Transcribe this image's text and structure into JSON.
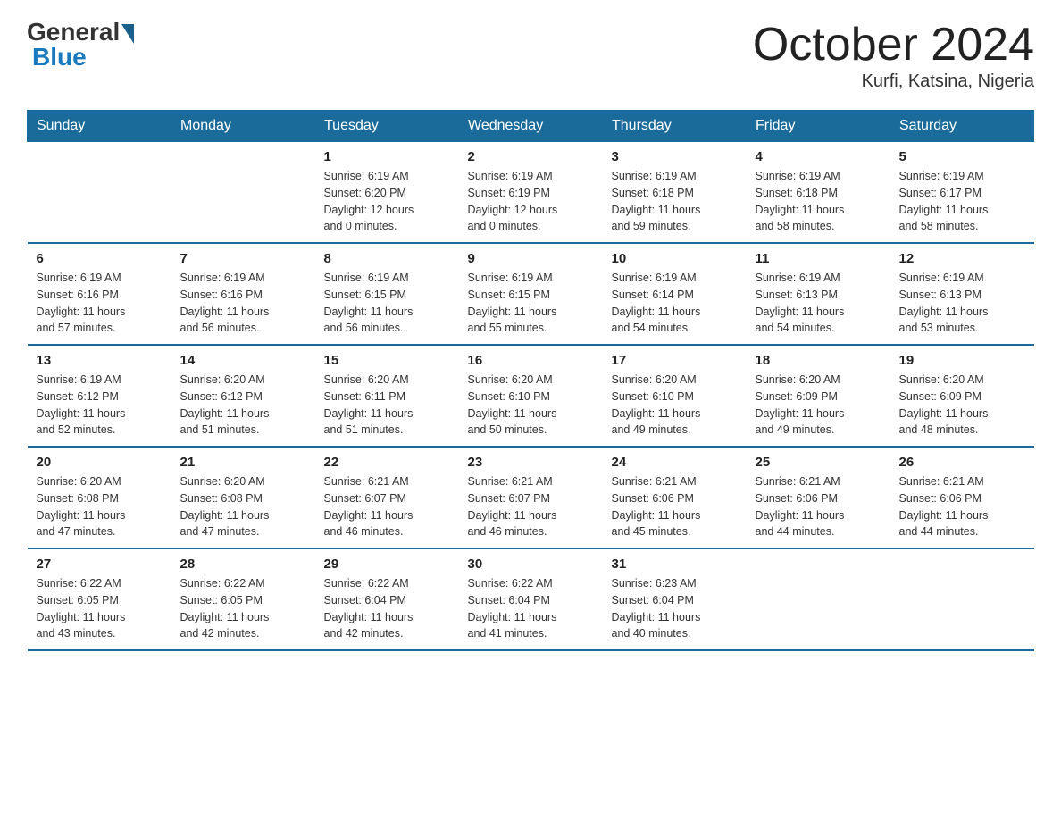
{
  "logo": {
    "general": "General",
    "blue": "Blue"
  },
  "title": "October 2024",
  "location": "Kurfi, Katsina, Nigeria",
  "days_header": [
    "Sunday",
    "Monday",
    "Tuesday",
    "Wednesday",
    "Thursday",
    "Friday",
    "Saturday"
  ],
  "weeks": [
    [
      {
        "day": "",
        "info": ""
      },
      {
        "day": "",
        "info": ""
      },
      {
        "day": "1",
        "info": "Sunrise: 6:19 AM\nSunset: 6:20 PM\nDaylight: 12 hours\nand 0 minutes."
      },
      {
        "day": "2",
        "info": "Sunrise: 6:19 AM\nSunset: 6:19 PM\nDaylight: 12 hours\nand 0 minutes."
      },
      {
        "day": "3",
        "info": "Sunrise: 6:19 AM\nSunset: 6:18 PM\nDaylight: 11 hours\nand 59 minutes."
      },
      {
        "day": "4",
        "info": "Sunrise: 6:19 AM\nSunset: 6:18 PM\nDaylight: 11 hours\nand 58 minutes."
      },
      {
        "day": "5",
        "info": "Sunrise: 6:19 AM\nSunset: 6:17 PM\nDaylight: 11 hours\nand 58 minutes."
      }
    ],
    [
      {
        "day": "6",
        "info": "Sunrise: 6:19 AM\nSunset: 6:16 PM\nDaylight: 11 hours\nand 57 minutes."
      },
      {
        "day": "7",
        "info": "Sunrise: 6:19 AM\nSunset: 6:16 PM\nDaylight: 11 hours\nand 56 minutes."
      },
      {
        "day": "8",
        "info": "Sunrise: 6:19 AM\nSunset: 6:15 PM\nDaylight: 11 hours\nand 56 minutes."
      },
      {
        "day": "9",
        "info": "Sunrise: 6:19 AM\nSunset: 6:15 PM\nDaylight: 11 hours\nand 55 minutes."
      },
      {
        "day": "10",
        "info": "Sunrise: 6:19 AM\nSunset: 6:14 PM\nDaylight: 11 hours\nand 54 minutes."
      },
      {
        "day": "11",
        "info": "Sunrise: 6:19 AM\nSunset: 6:13 PM\nDaylight: 11 hours\nand 54 minutes."
      },
      {
        "day": "12",
        "info": "Sunrise: 6:19 AM\nSunset: 6:13 PM\nDaylight: 11 hours\nand 53 minutes."
      }
    ],
    [
      {
        "day": "13",
        "info": "Sunrise: 6:19 AM\nSunset: 6:12 PM\nDaylight: 11 hours\nand 52 minutes."
      },
      {
        "day": "14",
        "info": "Sunrise: 6:20 AM\nSunset: 6:12 PM\nDaylight: 11 hours\nand 51 minutes."
      },
      {
        "day": "15",
        "info": "Sunrise: 6:20 AM\nSunset: 6:11 PM\nDaylight: 11 hours\nand 51 minutes."
      },
      {
        "day": "16",
        "info": "Sunrise: 6:20 AM\nSunset: 6:10 PM\nDaylight: 11 hours\nand 50 minutes."
      },
      {
        "day": "17",
        "info": "Sunrise: 6:20 AM\nSunset: 6:10 PM\nDaylight: 11 hours\nand 49 minutes."
      },
      {
        "day": "18",
        "info": "Sunrise: 6:20 AM\nSunset: 6:09 PM\nDaylight: 11 hours\nand 49 minutes."
      },
      {
        "day": "19",
        "info": "Sunrise: 6:20 AM\nSunset: 6:09 PM\nDaylight: 11 hours\nand 48 minutes."
      }
    ],
    [
      {
        "day": "20",
        "info": "Sunrise: 6:20 AM\nSunset: 6:08 PM\nDaylight: 11 hours\nand 47 minutes."
      },
      {
        "day": "21",
        "info": "Sunrise: 6:20 AM\nSunset: 6:08 PM\nDaylight: 11 hours\nand 47 minutes."
      },
      {
        "day": "22",
        "info": "Sunrise: 6:21 AM\nSunset: 6:07 PM\nDaylight: 11 hours\nand 46 minutes."
      },
      {
        "day": "23",
        "info": "Sunrise: 6:21 AM\nSunset: 6:07 PM\nDaylight: 11 hours\nand 46 minutes."
      },
      {
        "day": "24",
        "info": "Sunrise: 6:21 AM\nSunset: 6:06 PM\nDaylight: 11 hours\nand 45 minutes."
      },
      {
        "day": "25",
        "info": "Sunrise: 6:21 AM\nSunset: 6:06 PM\nDaylight: 11 hours\nand 44 minutes."
      },
      {
        "day": "26",
        "info": "Sunrise: 6:21 AM\nSunset: 6:06 PM\nDaylight: 11 hours\nand 44 minutes."
      }
    ],
    [
      {
        "day": "27",
        "info": "Sunrise: 6:22 AM\nSunset: 6:05 PM\nDaylight: 11 hours\nand 43 minutes."
      },
      {
        "day": "28",
        "info": "Sunrise: 6:22 AM\nSunset: 6:05 PM\nDaylight: 11 hours\nand 42 minutes."
      },
      {
        "day": "29",
        "info": "Sunrise: 6:22 AM\nSunset: 6:04 PM\nDaylight: 11 hours\nand 42 minutes."
      },
      {
        "day": "30",
        "info": "Sunrise: 6:22 AM\nSunset: 6:04 PM\nDaylight: 11 hours\nand 41 minutes."
      },
      {
        "day": "31",
        "info": "Sunrise: 6:23 AM\nSunset: 6:04 PM\nDaylight: 11 hours\nand 40 minutes."
      },
      {
        "day": "",
        "info": ""
      },
      {
        "day": "",
        "info": ""
      }
    ]
  ]
}
